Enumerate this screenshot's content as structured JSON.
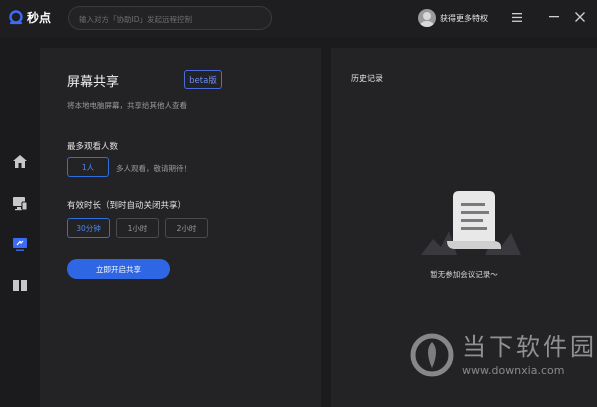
{
  "app": {
    "name": "秒点",
    "brand_color": "#3b6cf5"
  },
  "search": {
    "placeholder": "输入对方「协助ID」发起远程控制"
  },
  "user": {
    "label": "获得更多特权"
  },
  "window": {
    "menu_icon": "menu-icon",
    "minimize_icon": "minimize-icon",
    "close_icon": "close-icon"
  },
  "sidebar": {
    "items": [
      {
        "icon": "home-icon"
      },
      {
        "icon": "remote-device-icon"
      },
      {
        "icon": "screen-share-icon",
        "active": true
      },
      {
        "icon": "book-icon"
      }
    ]
  },
  "share": {
    "title": "屏幕共享",
    "badge": "beta版",
    "subtitle": "将本地电脑屏幕，共享给其他人查看",
    "max_viewers_label": "最多观看人数",
    "max_viewers_value": "1人",
    "max_viewers_hint": "多人观看，敬请期待！",
    "duration_label": "有效时长（到时自动关闭共享）",
    "durations": [
      "30分钟",
      "1小时",
      "2小时"
    ],
    "selected_duration": "30分钟",
    "start_button": "立即开启共享"
  },
  "history": {
    "title": "历史记录",
    "empty_text": "暂无参加会议记录～"
  },
  "watermark": {
    "name": "当下软件园",
    "url": "www.downxia.com"
  }
}
